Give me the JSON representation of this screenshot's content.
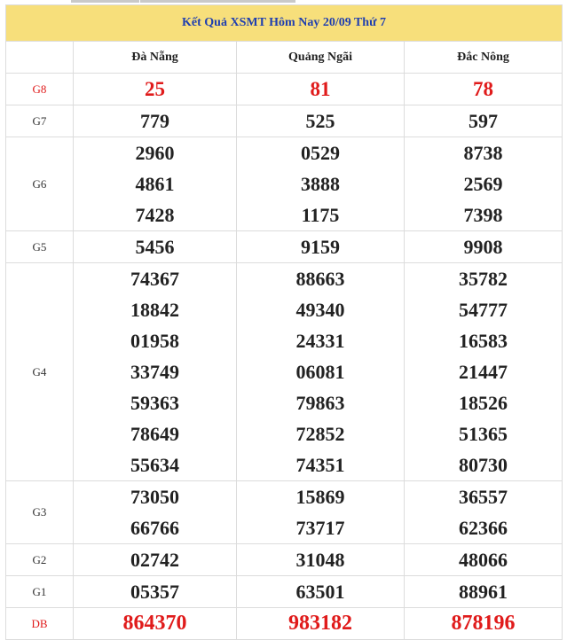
{
  "title": "Kết Quả XSMT Hôm Nay 20/09 Thứ 7",
  "columns": [
    "Đà Nẵng",
    "Quảng Ngãi",
    "Đắc Nông"
  ],
  "rows": [
    {
      "label": "G8",
      "values": [
        [
          "25"
        ],
        [
          "81"
        ],
        [
          "78"
        ]
      ]
    },
    {
      "label": "G7",
      "values": [
        [
          "779"
        ],
        [
          "525"
        ],
        [
          "597"
        ]
      ]
    },
    {
      "label": "G6",
      "values": [
        [
          "2960",
          "4861",
          "7428"
        ],
        [
          "0529",
          "3888",
          "1175"
        ],
        [
          "8738",
          "2569",
          "7398"
        ]
      ]
    },
    {
      "label": "G5",
      "values": [
        [
          "5456"
        ],
        [
          "9159"
        ],
        [
          "9908"
        ]
      ]
    },
    {
      "label": "G4",
      "values": [
        [
          "74367",
          "18842",
          "01958",
          "33749",
          "59363",
          "78649",
          "55634"
        ],
        [
          "88663",
          "49340",
          "24331",
          "06081",
          "79863",
          "72852",
          "74351"
        ],
        [
          "35782",
          "54777",
          "16583",
          "21447",
          "18526",
          "51365",
          "80730"
        ]
      ]
    },
    {
      "label": "G3",
      "values": [
        [
          "73050",
          "66766"
        ],
        [
          "15869",
          "73717"
        ],
        [
          "36557",
          "62366"
        ]
      ]
    },
    {
      "label": "G2",
      "values": [
        [
          "02742"
        ],
        [
          "31048"
        ],
        [
          "48066"
        ]
      ]
    },
    {
      "label": "G1",
      "values": [
        [
          "05357"
        ],
        [
          "63501"
        ],
        [
          "88961"
        ]
      ]
    },
    {
      "label": "DB",
      "values": [
        [
          "864370"
        ],
        [
          "983182"
        ],
        [
          "878196"
        ]
      ]
    }
  ],
  "colors": {
    "title_bg": "#f7df7b",
    "title_text": "#1f3fb0",
    "highlight": "#e01b1b"
  }
}
